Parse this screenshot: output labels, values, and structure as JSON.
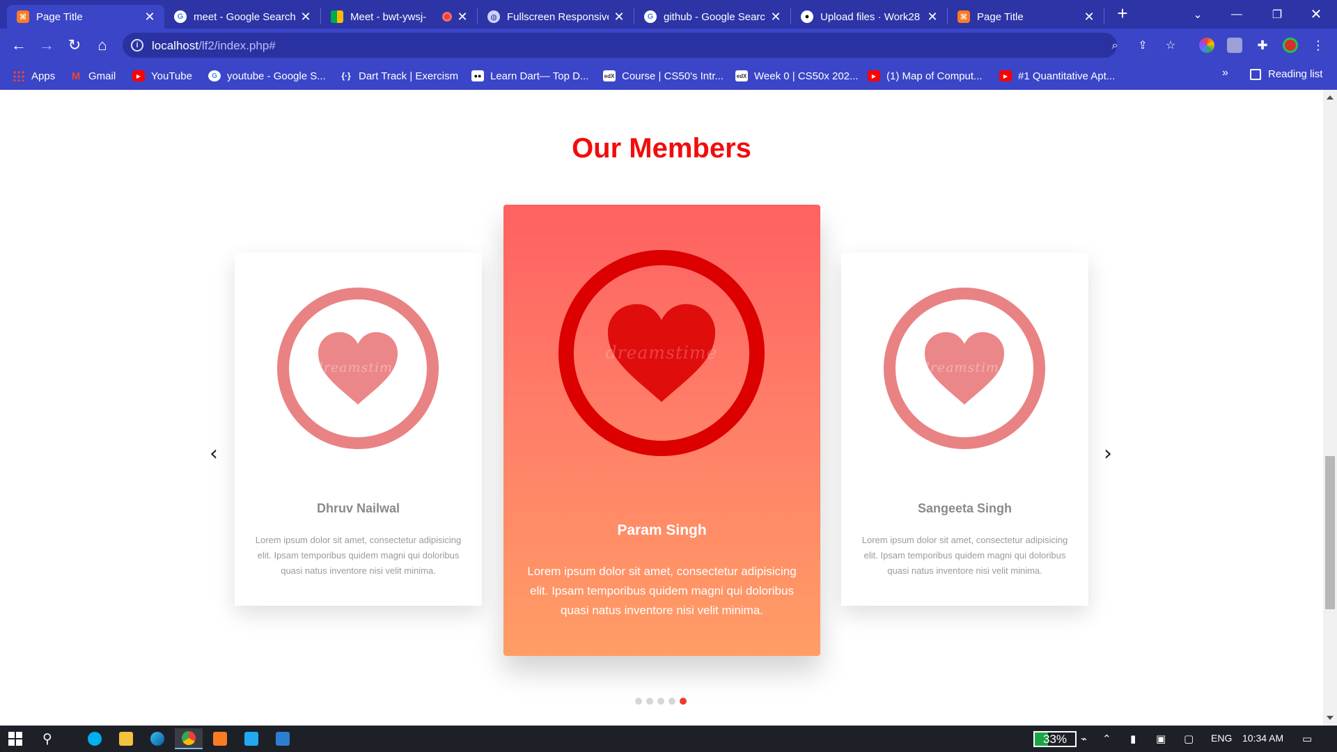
{
  "browser": {
    "tabs": [
      {
        "title": "Page Title",
        "icon": "xampp-icon",
        "active": true
      },
      {
        "title": "meet - Google Search",
        "icon": "google-icon",
        "active": false
      },
      {
        "title": "Meet - bwt-ywsj-",
        "icon": "google-meet-icon",
        "active": false
      },
      {
        "title": "Fullscreen Responsive",
        "icon": "globe-icon",
        "active": false
      },
      {
        "title": "github - Google Searc",
        "icon": "google-icon",
        "active": false
      },
      {
        "title": "Upload files · Work28",
        "icon": "github-icon",
        "active": false
      },
      {
        "title": "Page Title",
        "icon": "xampp-icon",
        "active": false
      }
    ],
    "url_host": "localhost",
    "url_path": "/lf2/index.php#",
    "bookmarks": [
      {
        "label": "Apps",
        "icon": "apps-grid-icon"
      },
      {
        "label": "Gmail",
        "icon": "gmail-icon"
      },
      {
        "label": "YouTube",
        "icon": "youtube-icon"
      },
      {
        "label": "youtube - Google S...",
        "icon": "google-icon"
      },
      {
        "label": "Dart Track | Exercism",
        "icon": "exercism-icon"
      },
      {
        "label": "Learn Dart— Top D...",
        "icon": "medium-icon"
      },
      {
        "label": "Course | CS50's Intr...",
        "icon": "edx-icon"
      },
      {
        "label": "Week 0 | CS50x 202...",
        "icon": "edx-icon"
      },
      {
        "label": "(1) Map of Comput...",
        "icon": "youtube-icon"
      },
      {
        "label": "#1 Quantitative Apt...",
        "icon": "youtube-icon"
      }
    ],
    "bookmarks_overflow": "»",
    "reading_list": "Reading list"
  },
  "page": {
    "heading": "Our Members",
    "members": [
      {
        "name": "Dhruv Nailwal",
        "description": "Lorem ipsum dolor sit amet, consectetur adipisicing elit. Ipsam temporibus quidem magni qui doloribus quasi natus inventore nisi velit minima.",
        "watermark": "dreamstime"
      },
      {
        "name": "Param Singh",
        "description": "Lorem ipsum dolor sit amet, consectetur adipisicing elit. Ipsam temporibus quidem magni qui doloribus quasi natus inventore nisi velit minima.",
        "watermark": "dreamstime"
      },
      {
        "name": "Sangeeta Singh",
        "description": "Lorem ipsum dolor sit amet, consectetur adipisicing elit. Ipsam temporibus quidem magni qui doloribus quasi natus inventore nisi velit minima.",
        "watermark": "dreamstime"
      }
    ],
    "prev_arrow": "‹",
    "next_arrow": "›",
    "pagination": {
      "total": 5,
      "active_index": 4
    },
    "colors": {
      "heading": "#f20c0c",
      "accent_dot": "#ef3b2d",
      "center_top": "#fe6161",
      "center_bottom": "#ff9d66",
      "side_logo": "#e98283",
      "center_logo": "#dc0000"
    }
  },
  "taskbar": {
    "battery": "33%",
    "language": "ENG",
    "time": "10:34 AM"
  }
}
